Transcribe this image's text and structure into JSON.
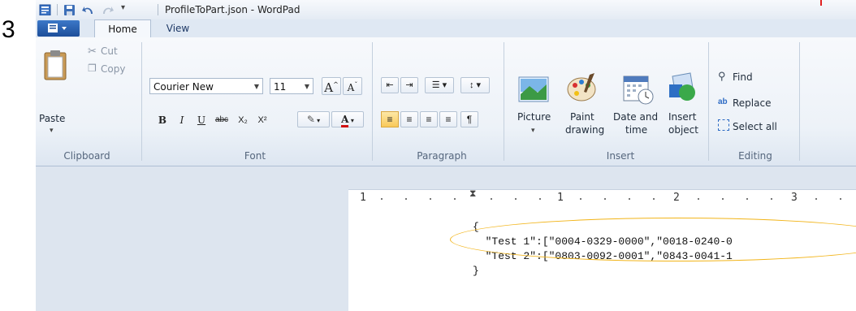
{
  "step_number": "3",
  "window": {
    "title": "ProfileToPart.json - WordPad"
  },
  "tabs": [
    {
      "label": "Home"
    },
    {
      "label": "View"
    }
  ],
  "clipboard": {
    "paste": "Paste",
    "cut": "Cut",
    "copy": "Copy",
    "group": "Clipboard"
  },
  "font": {
    "family": "Courier New",
    "size": "11",
    "group": "Font",
    "bold": "B",
    "italic": "I",
    "underline": "U",
    "strike": "abc",
    "sub": "X₂",
    "sup": "X²",
    "grow": "A",
    "shrink": "A",
    "color_letter": "A"
  },
  "paragraph": {
    "group": "Paragraph"
  },
  "insert": {
    "picture": "Picture",
    "paint": [
      "Paint",
      "drawing"
    ],
    "datetime": [
      "Date and",
      "time"
    ],
    "object": [
      "Insert",
      "object"
    ],
    "group": "Insert"
  },
  "editing": {
    "find": "Find",
    "replace": "Replace",
    "select_all": "Select all",
    "group": "Editing"
  },
  "ruler": {
    "labels": [
      "1",
      "1",
      "2",
      "3"
    ]
  },
  "document": {
    "lines": [
      "{",
      "  \"Test 1\":[\"0004-0329-0000\",\"0018-0240-0",
      "  \"Test 2\":[\"0803-0092-0001\",\"0843-0041-1",
      "}"
    ]
  },
  "colors": {
    "highlight_ellipse": "#f2b418",
    "accent": "#1d4e9a"
  }
}
